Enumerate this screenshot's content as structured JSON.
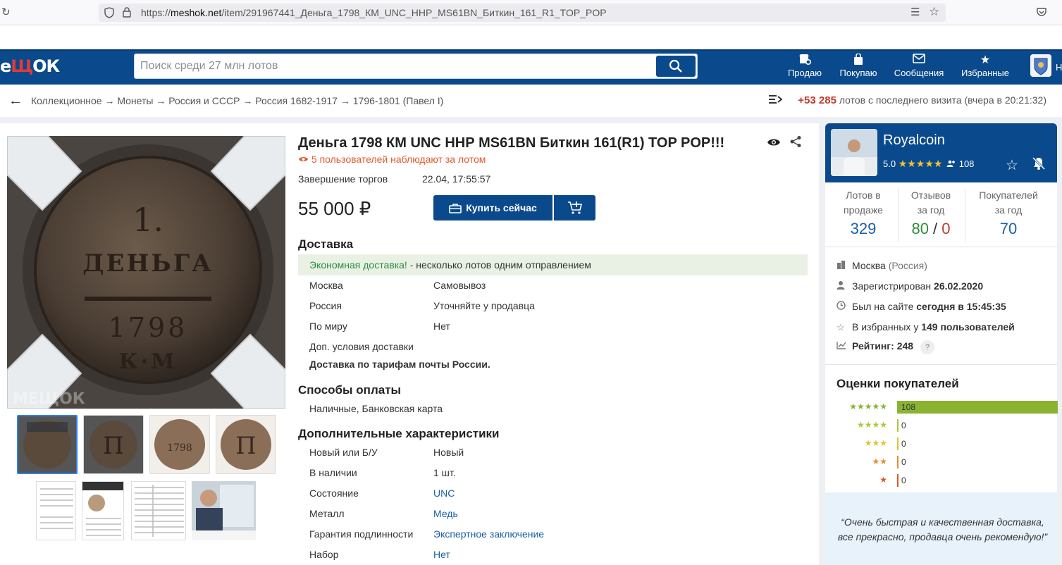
{
  "browser": {
    "url_prefix": "https://",
    "url_host": "meshok.net",
    "url_path": "/item/291967441_Деньга_1798_КМ_UNC_ННР_MS61BN_Биткин_161_R1_TOP_POP"
  },
  "header": {
    "logo_left": "е",
    "logo_mid": "Щ",
    "logo_right": "ОК",
    "search_placeholder": "Поиск среди 27 млн лотов",
    "nav": [
      {
        "label": "Продаю"
      },
      {
        "label": "Покупаю"
      },
      {
        "label": "Сообщения"
      },
      {
        "label": "Избранные"
      }
    ],
    "user_letter": "Н"
  },
  "breadcrumbs": {
    "items": [
      "Коллекционное",
      "Монеты",
      "Россия и СССР",
      "Россия 1682-1917",
      "1796-1801 (Павел I)"
    ],
    "separator": "→",
    "new_count": "+53 285",
    "new_text": "лотов с последнего визита (вчера в 20:21:32)"
  },
  "lot": {
    "title": "Деньга 1798 КМ UNC ННР MS61BN Биткин 161(R1) TOP POP!!!",
    "watchers": "5 пользователей наблюдают за лотом",
    "end_label": "Завершение торгов",
    "end_value": "22.04, 17:55:57",
    "price": "55 000 ₽",
    "buy_label": "Купить сейчас",
    "coin_text": {
      "denom": "1.",
      "word": "ДЕНЬГА",
      "year": "1798",
      "mint": "К·М"
    },
    "watermark": "МЕЩОК"
  },
  "delivery": {
    "heading": "Доставка",
    "promo_green": "Экономная доставка!",
    "promo_rest": " - несколько лотов одним отправлением",
    "rows": [
      {
        "label": "Москва",
        "value": "Самовывоз"
      },
      {
        "label": "Россия",
        "value": "Уточняйте у продавца"
      },
      {
        "label": "По миру",
        "value": "Нет"
      }
    ],
    "extra_label": "Доп. условия доставки",
    "extra_value": "Доставка по тарифам почты России."
  },
  "payment": {
    "heading": "Способы оплаты",
    "value": "Наличные, Банковская карта"
  },
  "specs": {
    "heading": "Дополнительные характеристики",
    "rows": [
      {
        "label": "Новый или Б/У",
        "value": "Новый",
        "link": false
      },
      {
        "label": "В наличии",
        "value": "1 шт.",
        "link": false
      },
      {
        "label": "Состояние",
        "value": "UNC",
        "link": true
      },
      {
        "label": "Металл",
        "value": "Медь",
        "link": true
      },
      {
        "label": "Гарантия подлинности",
        "value": "Экспертное заключение",
        "link": true
      },
      {
        "label": "Набор",
        "value": "Нет",
        "link": true
      }
    ]
  },
  "seller": {
    "name": "Royalcoin",
    "rating": "5.0",
    "stars": "★★★★★",
    "review_count": "108",
    "stats": [
      {
        "label1": "Лотов в",
        "label2": "продаже",
        "value": "329"
      },
      {
        "label1": "Отзывов",
        "label2": "за год",
        "pos": "80",
        "slash": " / ",
        "neg": "0"
      },
      {
        "label1": "Покупателей",
        "label2": "за год",
        "value": "70"
      }
    ],
    "city": "Москва",
    "country": "(Россия)",
    "registered_label": "Зарегистрирован ",
    "registered_value": "26.02.2020",
    "seen_label": "Был на сайте ",
    "seen_value": "сегодня в 15:45:35",
    "fav_label": "В избранных у ",
    "fav_value": "149 пользователей",
    "rating_label": "Рейтинг: ",
    "rating_value": "248",
    "help_mark": "?",
    "reviews_heading": "Оценки покупателей",
    "review_bars": [
      {
        "stars": "★★★★★",
        "count": "108",
        "fraction": 1.0,
        "color": "#8ab332"
      },
      {
        "stars": "★★★★",
        "count": "0",
        "fraction": 0,
        "color": "#b5c535"
      },
      {
        "stars": "★★★",
        "count": "0",
        "fraction": 0,
        "color": "#e3c22b"
      },
      {
        "stars": "★★",
        "count": "0",
        "fraction": 0,
        "color": "#e88c2a"
      },
      {
        "stars": "★",
        "count": "0",
        "fraction": 0,
        "color": "#e0562a"
      }
    ],
    "quote": "“Очень быстрая и качественная доставка, все прекрасно, продавца очень рекомендую!”"
  },
  "colors": {
    "brand_blue": "#0a4a8c",
    "accent_red": "#c0392b",
    "link_blue": "#1a5fa8",
    "positive_green": "#2e8b3e",
    "watch_orange": "#e05a2b"
  }
}
